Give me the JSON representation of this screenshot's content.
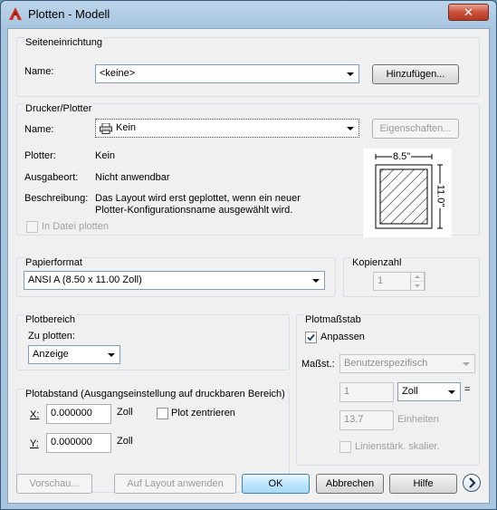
{
  "window": {
    "title": "Plotten - Modell",
    "close_label": "✕",
    "app_icon": "autocad-icon"
  },
  "seiteneinrichtung": {
    "title": "Seiteneinrichtung",
    "name_label": "Name:",
    "name_value": "<keine>",
    "add_button": "Hinzufügen..."
  },
  "drucker": {
    "title": "Drucker/Plotter",
    "name_label": "Name:",
    "name_value": "Kein",
    "printer_icon": "printer-icon",
    "properties_button": "Eigenschaften...",
    "plotter_label": "Plotter:",
    "plotter_value": "Kein",
    "ausgabeort_label": "Ausgabeort:",
    "ausgabeort_value": "Nicht anwendbar",
    "beschreibung_label": "Beschreibung:",
    "beschreibung_line1": "Das Layout wird erst geplottet, wenn ein neuer",
    "beschreibung_line2": "Plotter-Konfigurationsname ausgewählt wird.",
    "in_datei_label": "In Datei plotten",
    "preview_width": "8.5\"",
    "preview_height": "11.0\""
  },
  "papierformat": {
    "title": "Papierformat",
    "value": "ANSI A (8.50 x 11.00 Zoll)"
  },
  "kopienzahl": {
    "title": "Kopienzahl",
    "value": "1"
  },
  "plotbereich": {
    "title": "Plotbereich",
    "zu_plotten_label": "Zu plotten:",
    "zu_plotten_value": "Anzeige"
  },
  "plotabstand": {
    "title": "Plotabstand (Ausgangseinstellung auf druckbaren Bereich)",
    "x_label": "X:",
    "x_value": "0.000000",
    "x_unit": "Zoll",
    "y_label": "Y:",
    "y_value": "0.000000",
    "y_unit": "Zoll",
    "center_label": "Plot zentrieren"
  },
  "plotmassstab": {
    "title": "Plotmaßstab",
    "anpassen_label": "Anpassen",
    "massst_label": "Maßst.:",
    "massst_value": "Benutzerspezifisch",
    "value1": "1",
    "unit1": "Zoll",
    "equals": "=",
    "value2": "13.7",
    "unit2": "Einheiten",
    "linien_label": "Linienstärk. skalier."
  },
  "footer": {
    "vorschau": "Vorschau...",
    "auf_layout": "Auf Layout anwenden",
    "ok": "OK",
    "abbrechen": "Abbrechen",
    "hilfe": "Hilfe",
    "expand_icon": "chevron-right-icon"
  }
}
